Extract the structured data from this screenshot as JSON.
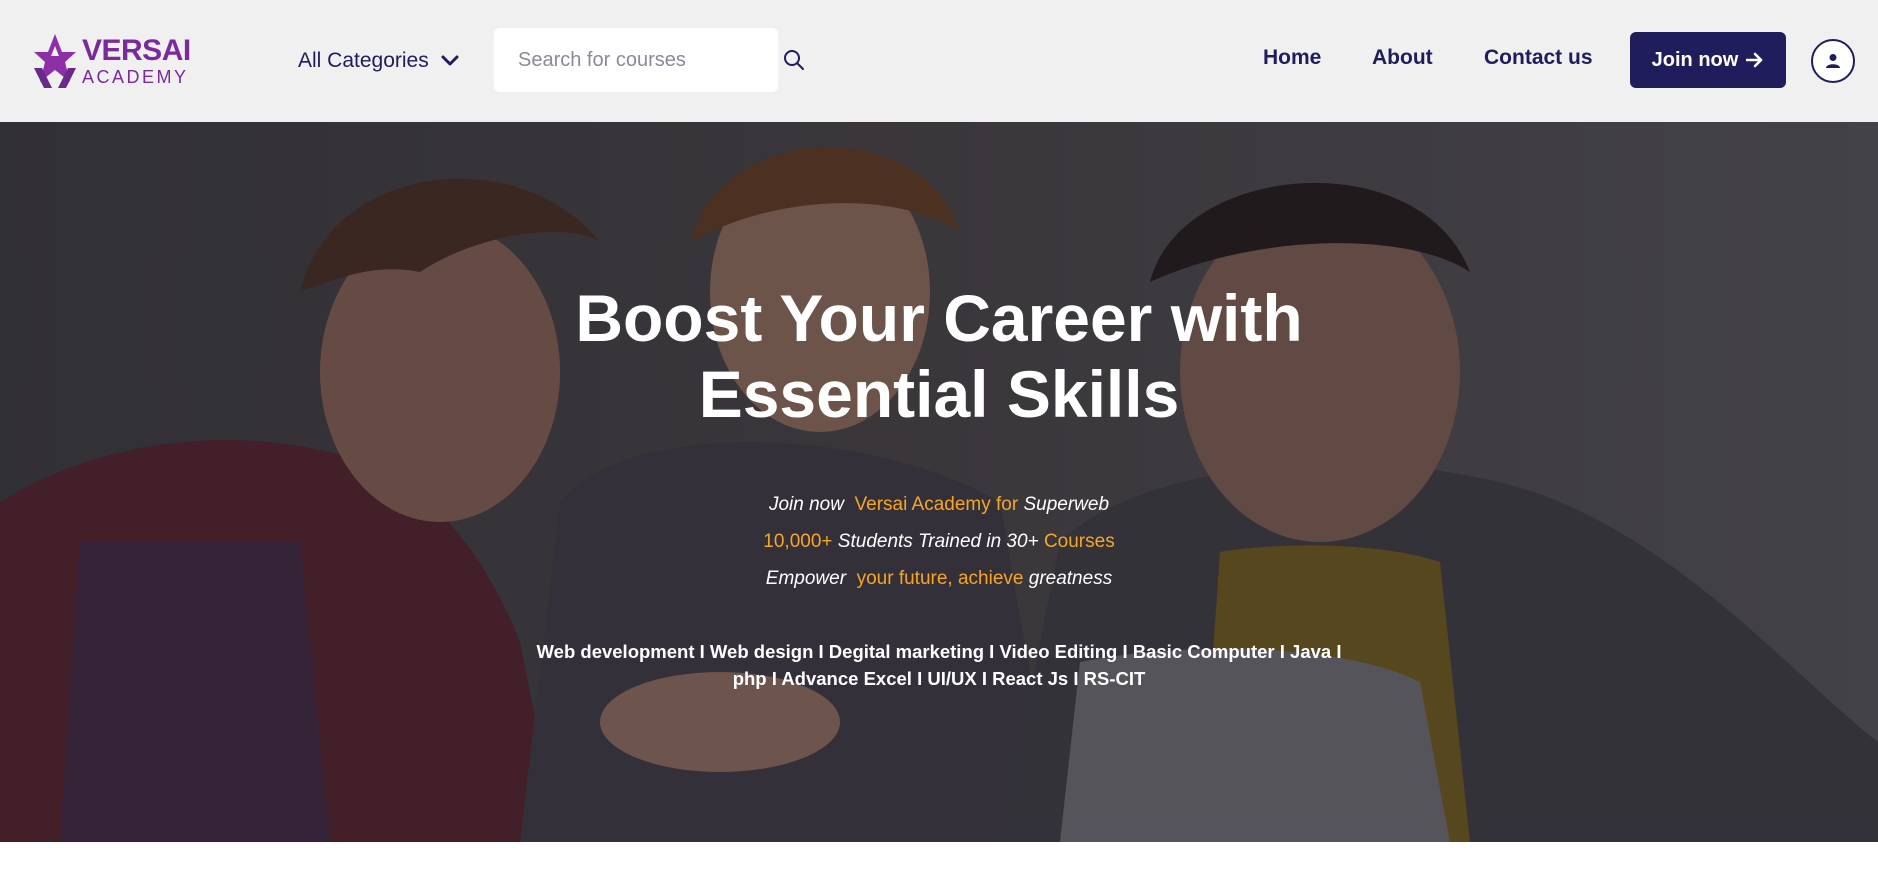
{
  "brand": {
    "name_top": "VERSAI",
    "name_bottom": "ACADEMY",
    "color": "#7b2a9c"
  },
  "header": {
    "categories_label": "All Categories",
    "search": {
      "placeholder": "Search for courses",
      "value": ""
    },
    "nav": [
      {
        "label": "Home"
      },
      {
        "label": "About"
      },
      {
        "label": "Contact us"
      }
    ],
    "join_label": "Join now",
    "icons": {
      "categories": "chevron-down-icon",
      "search": "search-icon",
      "join": "arrow-right-icon",
      "account": "user-icon"
    }
  },
  "hero": {
    "title_line1": "Boost Your Career with",
    "title_line2": "Essential Skills",
    "line1": {
      "a": "Join now",
      "b": "Versai Academy for",
      "c": "Superweb"
    },
    "line2": {
      "a": "10,000+",
      "b": "Students Trained in 30+",
      "c": "Courses"
    },
    "line3": {
      "a": "Empower",
      "b": "your future, achieve",
      "c": "greatness"
    },
    "courses_line1": "Web development I Web design I Degital marketing I Video Editing I Basic Computer I Java I",
    "courses_line2": "php I Advance Excel I UI/UX I React Js I RS-CIT"
  },
  "colors": {
    "primary": "#1f1d5c",
    "accent": "#f6a623",
    "header_bg": "#f0f0f0",
    "brand": "#7b2a9c"
  }
}
